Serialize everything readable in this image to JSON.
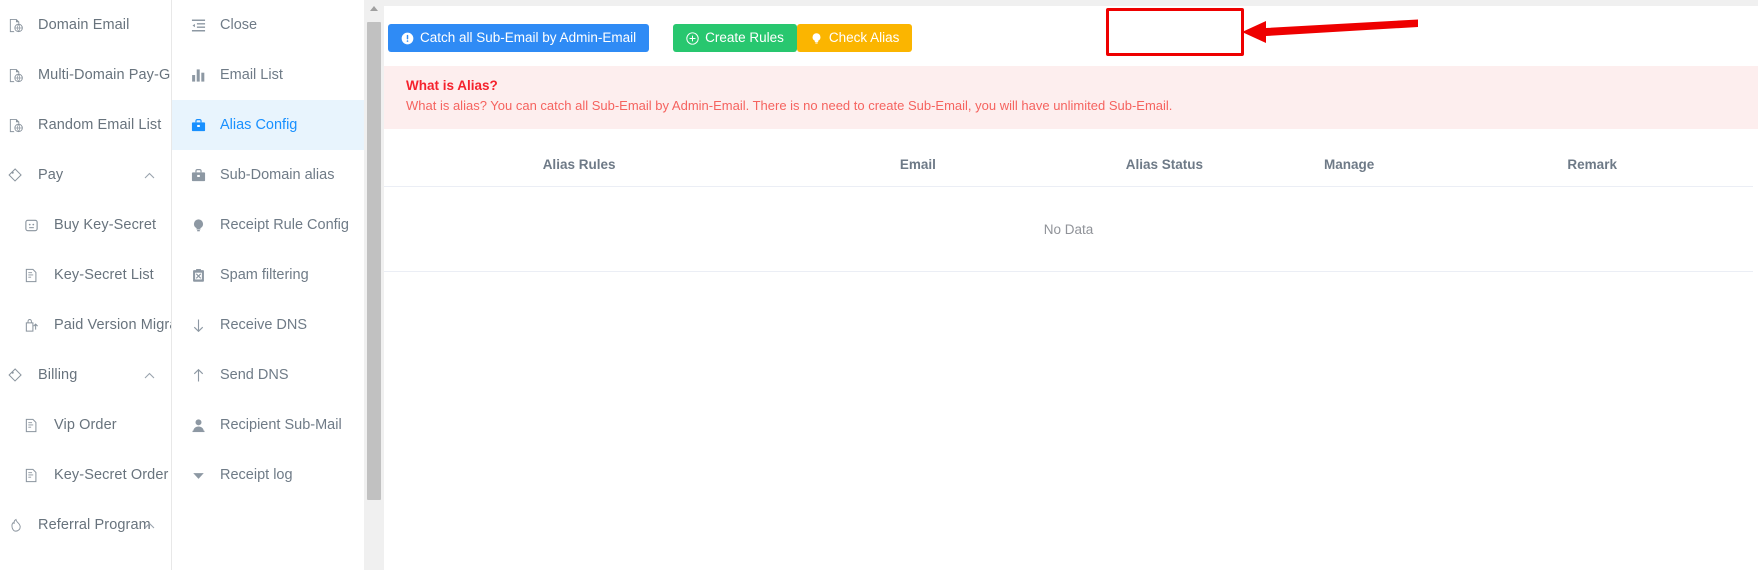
{
  "sidebar_primary": {
    "items": [
      {
        "label": "Domain Email",
        "icon": "domain-globe-icon",
        "sub": false,
        "caret": ""
      },
      {
        "label": "Multi-Domain Pay-Group",
        "icon": "domain-globe-icon",
        "sub": false,
        "caret": ""
      },
      {
        "label": "Random Email List",
        "icon": "domain-globe-icon",
        "sub": false,
        "caret": ""
      },
      {
        "label": "Pay",
        "icon": "pay-tag-icon",
        "sub": false,
        "caret": "chevron-up-icon"
      },
      {
        "label": "Buy Key-Secret",
        "icon": "wallet-icon",
        "sub": true,
        "caret": ""
      },
      {
        "label": "Key-Secret List",
        "icon": "list-doc-icon",
        "sub": true,
        "caret": ""
      },
      {
        "label": "Paid Version Migration",
        "icon": "upload-bag-icon",
        "sub": true,
        "caret": ""
      },
      {
        "label": "Billing",
        "icon": "pay-tag-icon",
        "sub": false,
        "caret": "chevron-up-icon"
      },
      {
        "label": "Vip Order",
        "icon": "list-doc-icon",
        "sub": true,
        "caret": ""
      },
      {
        "label": "Key-Secret Order",
        "icon": "list-doc-icon",
        "sub": true,
        "caret": ""
      },
      {
        "label": "Referral Program",
        "icon": "gift-icon",
        "sub": false,
        "caret": "chevron-up-icon"
      }
    ]
  },
  "sidebar_secondary": {
    "items": [
      {
        "label": "Close",
        "icon": "collapse-menu-icon",
        "active": false
      },
      {
        "label": "Email List",
        "icon": "bar-chart-icon",
        "active": false
      },
      {
        "label": "Alias Config",
        "icon": "briefcase-icon",
        "active": true
      },
      {
        "label": "Sub-Domain alias",
        "icon": "briefcase-icon",
        "active": false
      },
      {
        "label": "Receipt Rule Config",
        "icon": "bulb-icon",
        "active": false
      },
      {
        "label": "Spam filtering",
        "icon": "spam-clipboard-icon",
        "active": false
      },
      {
        "label": "Receive DNS",
        "icon": "arrow-down-icon",
        "active": false
      },
      {
        "label": "Send DNS",
        "icon": "arrow-up-icon",
        "active": false
      },
      {
        "label": "Recipient Sub-Mail",
        "icon": "user-icon",
        "active": false
      },
      {
        "label": "Receipt log",
        "icon": "caret-down-icon",
        "active": false
      }
    ]
  },
  "toolbar": {
    "catch_all_label": "Catch all Sub-Email by Admin-Email",
    "catch_all_icon": "exclamation-circle-icon",
    "create_rules_label": "Create Rules",
    "create_rules_icon": "plus-circle-icon",
    "check_alias_label": "Check Alias",
    "check_alias_icon": "bulb-icon",
    "colors": {
      "blue": "#2f8bf5",
      "green": "#28c76f",
      "orange": "#fbb500",
      "highlight": "#ee0000"
    }
  },
  "alert": {
    "title": "What is Alias?",
    "description": "What is alias? You can catch all Sub-Email by Admin-Email. There is no need to create Sub-Email, you will have unlimited Sub-Email.",
    "bg_color": "#fdeeee",
    "text_color": "#f5222d"
  },
  "table": {
    "headers": [
      "Alias Rules",
      "Email",
      "Alias Status",
      "Manage",
      "Remark"
    ],
    "empty_text": "No Data",
    "rows": []
  },
  "annotation": {
    "arrow_icon": "left-arrow-annotation",
    "color": "#ee0000"
  }
}
